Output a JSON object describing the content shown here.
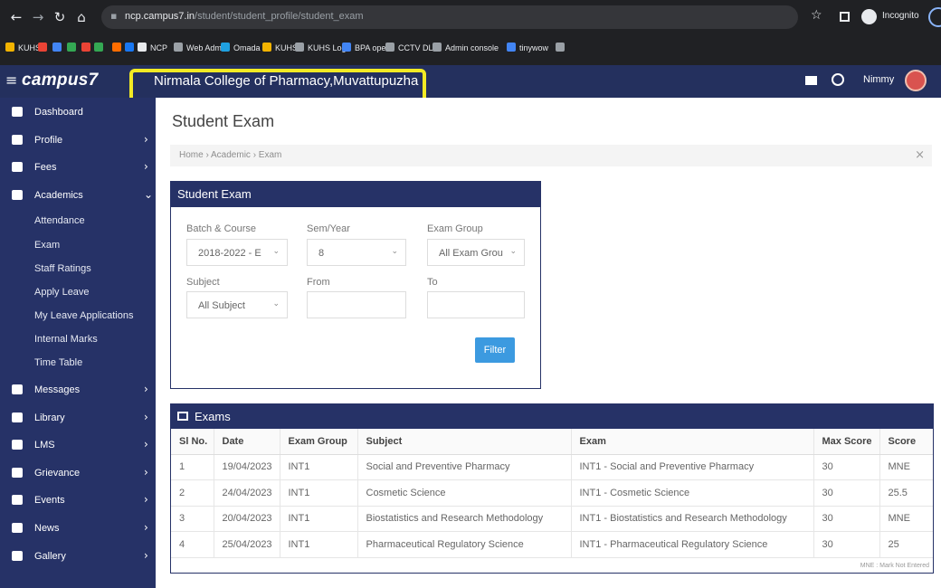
{
  "browser": {
    "url_host": "ncp.campus7.in",
    "url_path": "/student/student_profile/student_exam",
    "incognito_label": "Incognito",
    "bookmarks": [
      {
        "label": "KUHS",
        "color": "#f2b300"
      },
      {
        "label": "",
        "color": "#ea4335"
      },
      {
        "label": "",
        "color": "#4285f4"
      },
      {
        "label": "",
        "color": "#34a853"
      },
      {
        "label": "M",
        "color": "#ea4335"
      },
      {
        "label": "",
        "color": "#34a853"
      },
      {
        "label": "7",
        "color": "#ff6d00"
      },
      {
        "label": "",
        "color": "#1877f2"
      },
      {
        "label": "NCP",
        "color": "#e8eaed"
      },
      {
        "label": "Web Admin",
        "color": "#9aa0a6"
      },
      {
        "label": "Omada",
        "color": "#1fa0e0"
      },
      {
        "label": "KUHS",
        "color": "#f2b300"
      },
      {
        "label": "KUHS Log",
        "color": "#9aa0a6"
      },
      {
        "label": "BPA open",
        "color": "#4285f4"
      },
      {
        "label": "CCTV DL",
        "color": "#9aa0a6"
      },
      {
        "label": "Admin console",
        "color": "#9aa0a6"
      },
      {
        "label": "tinywow",
        "color": "#4285f4"
      },
      {
        "label": "",
        "color": "#9aa0a6"
      }
    ]
  },
  "app": {
    "brand": "campus7",
    "college": "Nirmala College of Pharmacy,Muvattupuzha",
    "user_name": "Nimmy",
    "colors": {
      "navy": "#263267",
      "topbar": "#24305e",
      "highlight": "#f2ea24",
      "button": "#3c9ae0"
    }
  },
  "sidebar": {
    "items": [
      {
        "label": "Dashboard",
        "icon": "dashboard-icon",
        "chevron": ""
      },
      {
        "label": "Profile",
        "icon": "user-icon",
        "chevron": "›"
      },
      {
        "label": "Fees",
        "icon": "money-icon",
        "chevron": "›"
      },
      {
        "label": "Academics",
        "icon": "graduation-cap-icon",
        "chevron": "⌄"
      }
    ],
    "academics_sub": [
      "Attendance",
      "Exam",
      "Staff Ratings",
      "Apply Leave",
      "My Leave Applications",
      "Internal Marks",
      "Time Table"
    ],
    "items_after": [
      {
        "label": "Messages",
        "icon": "envelope-icon",
        "chevron": "›"
      },
      {
        "label": "Library",
        "icon": "book-icon",
        "chevron": "›"
      },
      {
        "label": "LMS",
        "icon": "lms-icon",
        "chevron": "›"
      },
      {
        "label": "Grievance",
        "icon": "file-icon",
        "chevron": "›"
      },
      {
        "label": "Events",
        "icon": "calendar-icon",
        "chevron": "›"
      },
      {
        "label": "News",
        "icon": "newspaper-icon",
        "chevron": "›"
      },
      {
        "label": "Gallery",
        "icon": "image-icon",
        "chevron": "›"
      }
    ]
  },
  "page": {
    "title": "Student Exam",
    "breadcrumb": "Home › Academic › Exam",
    "close_glyph": "×"
  },
  "filter": {
    "title": "Student Exam",
    "batch_label": "Batch & Course",
    "batch_value": "2018-2022 - E",
    "sem_label": "Sem/Year",
    "sem_value": "8",
    "group_label": "Exam Group",
    "group_value": "All Exam Grou",
    "subject_label": "Subject",
    "subject_value": "All Subject",
    "from_label": "From",
    "to_label": "To",
    "button": "Filter"
  },
  "exams": {
    "title": "Exams",
    "headers": [
      "Sl No.",
      "Date",
      "Exam Group",
      "Subject",
      "Exam",
      "Max Score",
      "Score"
    ],
    "rows": [
      [
        "1",
        "19/04/2023",
        "INT1",
        "Social and Preventive Pharmacy",
        "INT1 - Social and Preventive Pharmacy",
        "30",
        "MNE"
      ],
      [
        "2",
        "24/04/2023",
        "INT1",
        "Cosmetic Science",
        "INT1 - Cosmetic Science",
        "30",
        "25.5"
      ],
      [
        "3",
        "20/04/2023",
        "INT1",
        "Biostatistics and Research Methodology",
        "INT1 - Biostatistics and Research Methodology",
        "30",
        "MNE"
      ],
      [
        "4",
        "25/04/2023",
        "INT1",
        "Pharmaceutical Regulatory Science",
        "INT1 - Pharmaceutical Regulatory Science",
        "30",
        "25"
      ]
    ],
    "legend": "MNE : Mark Not Entered"
  }
}
